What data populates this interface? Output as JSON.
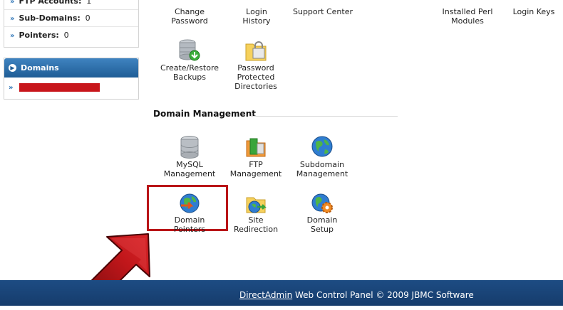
{
  "sidebar": {
    "stats": [
      {
        "label": "FTP Accounts:",
        "value": "1"
      },
      {
        "label": "Sub-Domains:",
        "value": "0"
      },
      {
        "label": "Pointers:",
        "value": "0"
      }
    ],
    "domains_title": "Domains"
  },
  "top_icons": [
    {
      "label": "Change Password"
    },
    {
      "label": "Login History"
    },
    {
      "label": "Support Center"
    },
    {
      "label": "Installed Perl Modules"
    },
    {
      "label": "Login Keys"
    }
  ],
  "tiles": {
    "backups": "Create/Restore Backups",
    "protected": "Password Protected Directories",
    "mysql": "MySQL Management",
    "ftp": "FTP Management",
    "subdomain": "Subdomain Management",
    "pointers": "Domain Pointers",
    "redirection": "Site Redirection",
    "setup": "Domain Setup"
  },
  "section_title": "Domain Management",
  "footer": {
    "link": "DirectAdmin",
    "text": " Web Control Panel © 2009 JBMC Software"
  },
  "colors": {
    "footer_bg": "#1d4c83",
    "domains_header_bg": "#2a6aa8",
    "highlight_red": "#b91518",
    "redacted": "#c8161b"
  }
}
